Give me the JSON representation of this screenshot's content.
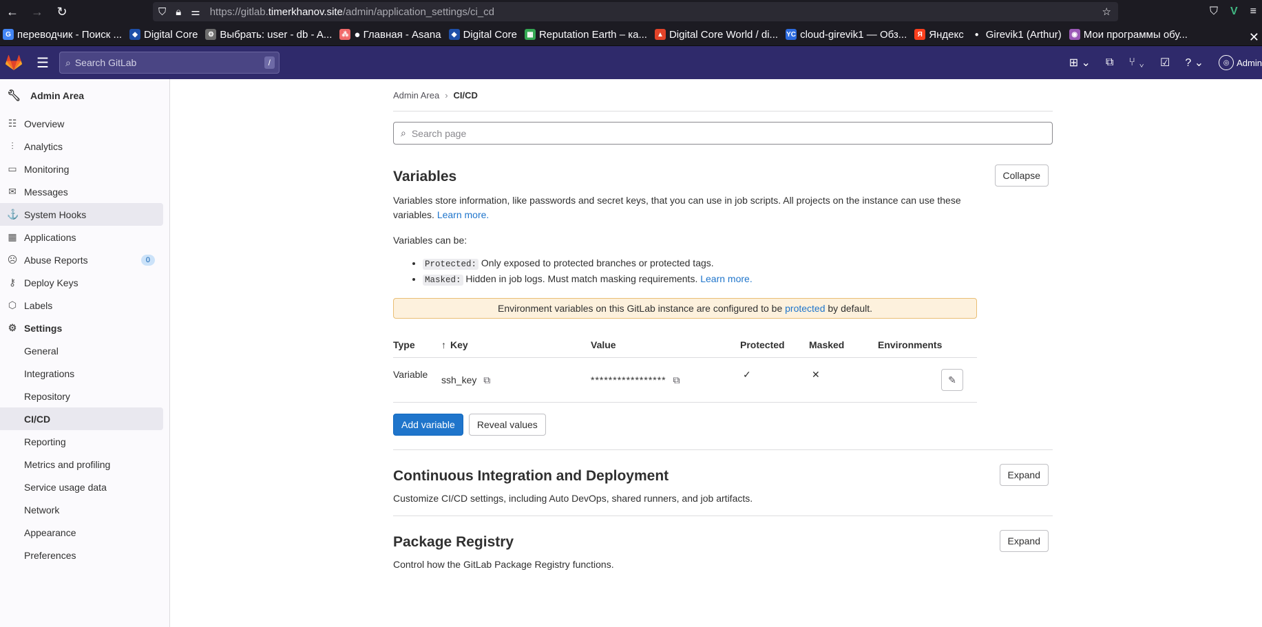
{
  "browser": {
    "url_prefix": "https://gitlab.",
    "url_host": "timerkhanov.site",
    "url_path": "/admin/application_settings/ci_cd",
    "bookmarks": [
      {
        "label": "переводчик - Поиск ...",
        "color": "#4285f4",
        "glyph": "G"
      },
      {
        "label": "Digital Core",
        "color": "#1e4fa8",
        "glyph": "◆"
      },
      {
        "label": "Выбрать: user - db - A...",
        "color": "#6d6d6d",
        "glyph": "⚙"
      },
      {
        "label": "● Главная - Asana",
        "color": "#f06a6a",
        "glyph": "⁂"
      },
      {
        "label": "Digital Core",
        "color": "#1e4fa8",
        "glyph": "◆"
      },
      {
        "label": "Reputation Earth – ка...",
        "color": "#34a853",
        "glyph": "▦"
      },
      {
        "label": "Digital Core World / di...",
        "color": "#e24329",
        "glyph": "▲"
      },
      {
        "label": "cloud-girevik1 — Обз...",
        "color": "#2d6cdf",
        "glyph": "YC"
      },
      {
        "label": "Яндекс",
        "color": "#fc3f1d",
        "glyph": "Я"
      },
      {
        "label": "Girevik1 (Arthur)",
        "color": "#ffffff",
        "glyph": "●"
      },
      {
        "label": "Мои программы обу...",
        "color": "#9b59b6",
        "glyph": "◉"
      }
    ]
  },
  "header": {
    "search_placeholder": "Search GitLab",
    "search_shortcut": "/",
    "user_label": "Admin"
  },
  "sidebar": {
    "title": "Admin Area",
    "items": [
      {
        "label": "Overview",
        "icon": "overview-icon",
        "glyph": "☷"
      },
      {
        "label": "Analytics",
        "icon": "analytics-icon",
        "glyph": "⫶"
      },
      {
        "label": "Monitoring",
        "icon": "monitor-icon",
        "glyph": "▭"
      },
      {
        "label": "Messages",
        "icon": "messages-icon",
        "glyph": "✉"
      },
      {
        "label": "System Hooks",
        "icon": "hook-icon",
        "glyph": "⚓"
      },
      {
        "label": "Applications",
        "icon": "applications-icon",
        "glyph": "▦"
      },
      {
        "label": "Abuse Reports",
        "icon": "abuse-icon",
        "glyph": "☹",
        "badge": "0"
      },
      {
        "label": "Deploy Keys",
        "icon": "key-icon",
        "glyph": "⚷"
      },
      {
        "label": "Labels",
        "icon": "label-icon",
        "glyph": "⬡"
      },
      {
        "label": "Settings",
        "icon": "settings-icon",
        "glyph": "⚙"
      }
    ],
    "settings_sub": [
      "General",
      "Integrations",
      "Repository",
      "CI/CD",
      "Reporting",
      "Metrics and profiling",
      "Service usage data",
      "Network",
      "Appearance",
      "Preferences"
    ]
  },
  "breadcrumb": {
    "parent": "Admin Area",
    "current": "CI/CD"
  },
  "search_page_placeholder": "Search page",
  "variables": {
    "title": "Variables",
    "collapse_label": "Collapse",
    "desc": "Variables store information, like passwords and secret keys, that you can use in job scripts. All projects on the instance can use these variables.",
    "learn_more": "Learn more.",
    "can_be": "Variables can be:",
    "protected_code": "Protected:",
    "protected_desc": "Only exposed to protected branches or protected tags.",
    "masked_code": "Masked:",
    "masked_desc": "Hidden in job logs. Must match masking requirements.",
    "masked_learn_more": "Learn more.",
    "alert_pre": "Environment variables on this GitLab instance are configured to be",
    "alert_link": "protected",
    "alert_post": "by default.",
    "columns": {
      "type": "Type",
      "key": "Key",
      "value": "Value",
      "protected": "Protected",
      "masked": "Masked",
      "environments": "Environments"
    },
    "rows": [
      {
        "type": "Variable",
        "key": "ssh_key",
        "value": "*****************",
        "protected": "✓",
        "masked": "✕"
      }
    ],
    "add_label": "Add variable",
    "reveal_label": "Reveal values"
  },
  "cicd": {
    "title": "Continuous Integration and Deployment",
    "expand_label": "Expand",
    "desc": "Customize CI/CD settings, including Auto DevOps, shared runners, and job artifacts."
  },
  "registry": {
    "title": "Package Registry",
    "expand_label": "Expand",
    "desc": "Control how the GitLab Package Registry functions."
  }
}
